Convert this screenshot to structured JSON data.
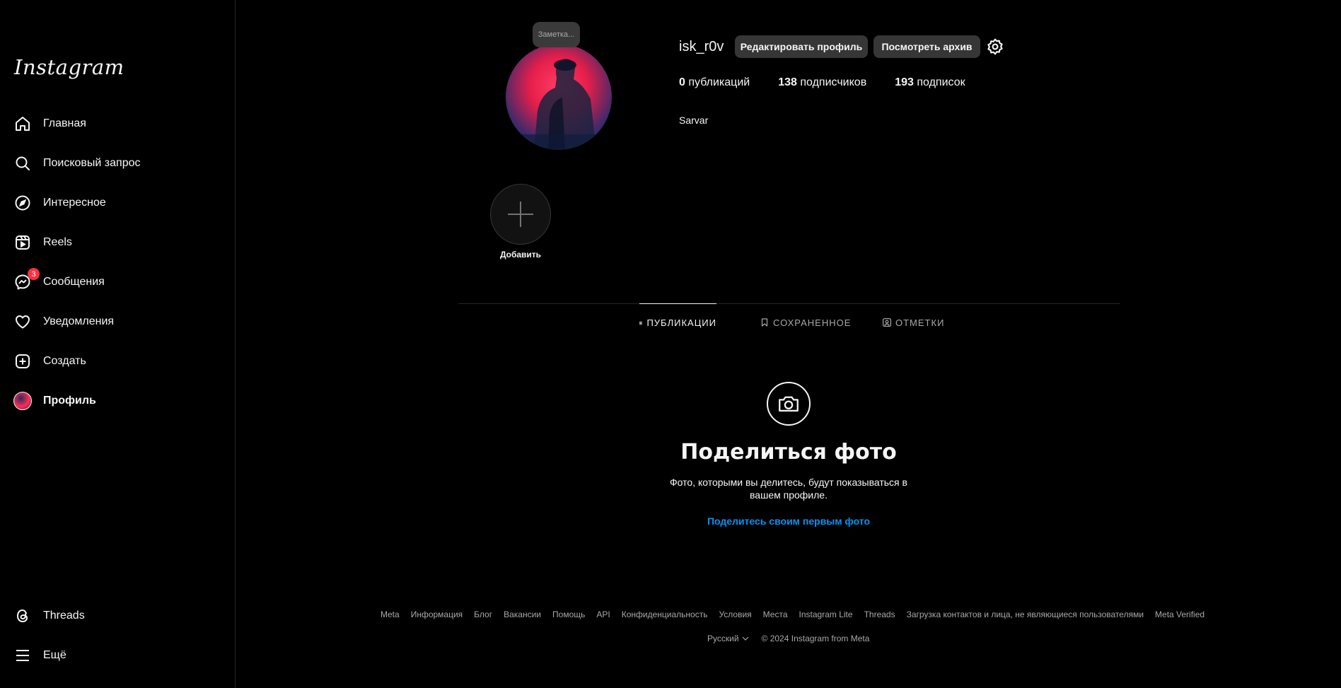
{
  "app": {
    "brand": "Instagram"
  },
  "sidebar": {
    "items": [
      {
        "label": "Главная",
        "icon": "home-icon"
      },
      {
        "label": "Поисковый запрос",
        "icon": "search-icon"
      },
      {
        "label": "Интересное",
        "icon": "compass-icon"
      },
      {
        "label": "Reels",
        "icon": "reels-icon"
      },
      {
        "label": "Сообщения",
        "icon": "messenger-icon",
        "badge": "3"
      },
      {
        "label": "Уведомления",
        "icon": "heart-icon"
      },
      {
        "label": "Создать",
        "icon": "plus-square-icon"
      },
      {
        "label": "Профиль",
        "icon": "avatar"
      }
    ],
    "bottom": [
      {
        "label": "Threads",
        "icon": "threads-icon"
      },
      {
        "label": "Ещё",
        "icon": "menu-icon"
      }
    ]
  },
  "profile": {
    "note": "Заметка...",
    "username": "isk_r0v",
    "edit_label": "Редактировать профиль",
    "archive_label": "Посмотреть архив",
    "posts_count": "0",
    "posts_label": "публикаций",
    "followers_count": "138",
    "followers_label": "подписчиков",
    "following_count": "193",
    "following_label": "подписок",
    "full_name": "Sarvar"
  },
  "highlight": {
    "label": "Добавить"
  },
  "tabs": [
    {
      "label": "ПУБЛИКАЦИИ"
    },
    {
      "label": "СОХРАНЕННОЕ"
    },
    {
      "label": "ОТМЕТКИ"
    }
  ],
  "empty_state": {
    "title": "Поделиться фото",
    "text": "Фото, которыми вы делитесь, будут показываться в вашем профиле.",
    "link": "Поделитесь своим первым фото"
  },
  "footer": {
    "links": [
      "Meta",
      "Информация",
      "Блог",
      "Вакансии",
      "Помощь",
      "API",
      "Конфиденциальность",
      "Условия",
      "Места",
      "Instagram Lite",
      "Threads",
      "Загрузка контактов и лица, не являющиеся пользователями",
      "Meta Verified"
    ],
    "language": "Русский",
    "copyright": "© 2024 Instagram from Meta"
  },
  "colors": {
    "accent": "#0095f6",
    "badge": "#ff3040",
    "background": "#000000"
  }
}
